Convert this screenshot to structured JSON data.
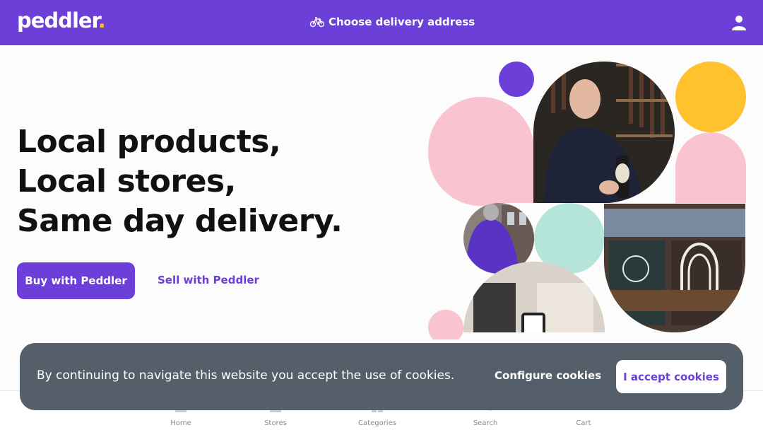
{
  "brand": {
    "name": "peddler",
    "dot": ".",
    "color": "#6c3fd8",
    "accent": "#ffb627"
  },
  "header": {
    "delivery_label": "Choose delivery address",
    "delivery_icon": "bicycle-icon",
    "user_icon": "user-icon"
  },
  "hero": {
    "lines": [
      "Local products,",
      "Local stores,",
      "Same day delivery."
    ],
    "buy_label": "Buy with Peddler",
    "sell_label": "Sell with Peddler"
  },
  "collage": {
    "images": [
      "wine-shop-owner-photo",
      "peddler-courier-photo",
      "kaasbar-storefront-photo",
      "phone-app-photo"
    ],
    "colors": {
      "pink": "#f9c3d0",
      "yellow": "#ffc12e",
      "purple": "#6c3fd8",
      "mint": "#b4e4da"
    }
  },
  "bottom_nav": [
    {
      "label": "Home",
      "icon": "home-icon"
    },
    {
      "label": "Stores",
      "icon": "store-icon"
    },
    {
      "label": "Categories",
      "icon": "categories-icon"
    },
    {
      "label": "Search",
      "icon": "search-icon"
    },
    {
      "label": "Cart",
      "icon": "cart-icon"
    }
  ],
  "cookie_banner": {
    "text": "By continuing to navigate this website you accept the use of cookies.",
    "configure_label": "Configure cookies",
    "accept_label": "I accept cookies"
  }
}
